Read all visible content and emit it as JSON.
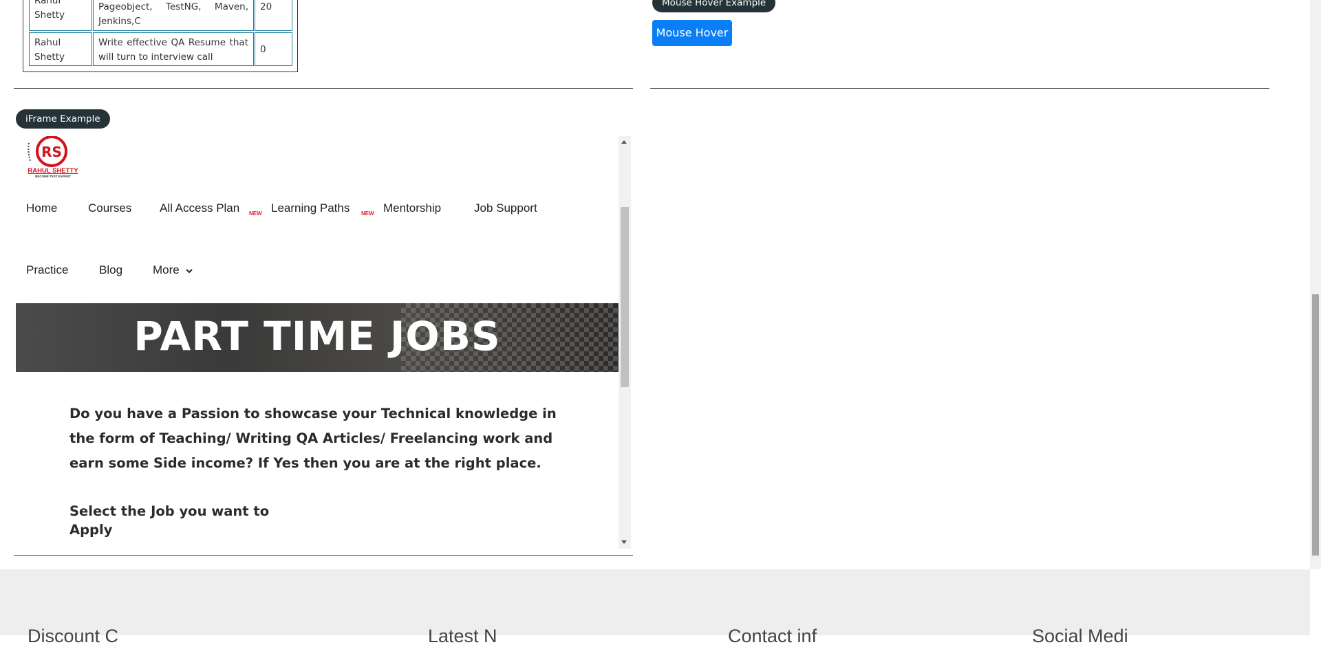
{
  "table": {
    "rows": [
      {
        "instructor": "Rahul Shetty",
        "course": "Pageobject, TestNG, Maven, Jenkins,C",
        "price": "20"
      },
      {
        "instructor": "Rahul Shetty",
        "course": "Write effective QA Resume that will turn to interview call",
        "price": "0"
      }
    ]
  },
  "mouse_hover": {
    "legend": "Mouse Hover Example",
    "button_label": "Mouse Hover"
  },
  "iframe": {
    "legend": "iFrame Example",
    "logo": {
      "name": "RAHUL SHETTY",
      "tagline": "BECOME TEST EXPERT"
    },
    "nav": {
      "home": "Home",
      "courses": "Courses",
      "all_access": "All Access Plan",
      "new_badge_1": "NEW",
      "learning_paths": "Learning Paths",
      "new_badge_2": "NEW",
      "mentorship": "Mentorship",
      "job_support": "Job Support",
      "practice": "Practice",
      "blog": "Blog",
      "more": "More"
    },
    "banner_title": "PART TIME JOBS",
    "intro": "Do you have a Passion to showcase your Technical knowledge in the form of Teaching/ Writing QA Articles/ Freelancing work and earn some Side income? If Yes then you are at the right place.",
    "select_job": "Select the Job you want to Apply"
  },
  "footer": {
    "headings": [
      "Discount C",
      "Latest N",
      "Contact inf",
      "Social Medi"
    ]
  },
  "colors": {
    "primary_button": "#0a7ef5",
    "legend_pill": "#253238",
    "table_border": "#1e7fa0",
    "new_badge": "#e81c2c",
    "logo_red": "#d0141e"
  },
  "icons": [
    "chevron-down-icon",
    "scroll-up-arrow-icon",
    "scroll-down-arrow-icon"
  ]
}
